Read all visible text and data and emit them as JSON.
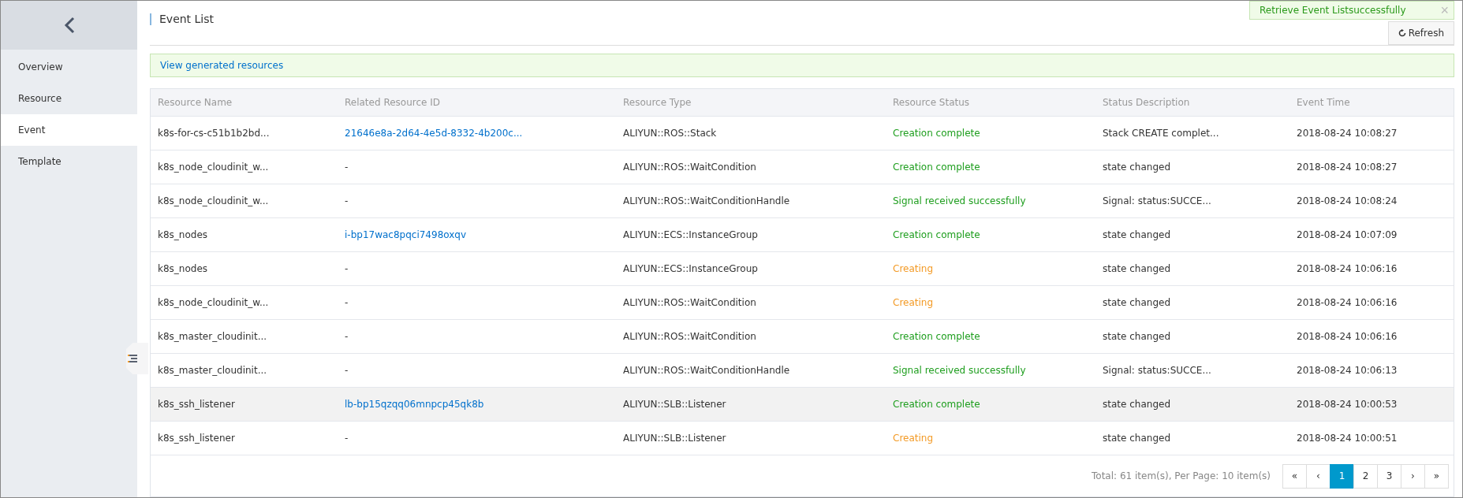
{
  "sidebar": {
    "items": [
      {
        "label": "Overview",
        "selected": false
      },
      {
        "label": "Resource",
        "selected": false
      },
      {
        "label": "Event",
        "selected": true
      },
      {
        "label": "Template",
        "selected": false
      }
    ]
  },
  "page": {
    "title": "Event List",
    "refresh": "Refresh"
  },
  "toast": {
    "message": "Retrieve Event Listsuccessfully",
    "close": "×"
  },
  "notice": {
    "link": "View generated resources"
  },
  "table": {
    "columns": [
      "Resource Name",
      "Related Resource ID",
      "Resource Type",
      "Resource Status",
      "Status Description",
      "Event Time"
    ],
    "rows": [
      {
        "name": "k8s-for-cs-c51b1b2bd...",
        "id": {
          "text": "21646e8a-2d64-4e5d-8332-4b200c...",
          "kind": "link"
        },
        "type": "ALIYUN::ROS::Stack",
        "status": {
          "text": "Creation complete",
          "kind": "done"
        },
        "description": "Stack CREATE complet...",
        "time": "2018-08-24 10:08:27",
        "selected": false
      },
      {
        "name": "k8s_node_cloudinit_w...",
        "id": {
          "text": "-",
          "kind": "plain"
        },
        "type": "ALIYUN::ROS::WaitCondition",
        "status": {
          "text": "Creation complete",
          "kind": "done"
        },
        "description": "state changed",
        "time": "2018-08-24 10:08:27",
        "selected": false
      },
      {
        "name": "k8s_node_cloudinit_w...",
        "id": {
          "text": "-",
          "kind": "plain"
        },
        "type": "ALIYUN::ROS::WaitConditionHandle",
        "status": {
          "text": "Signal received successfully",
          "kind": "done"
        },
        "description": "Signal: status:SUCCE...",
        "time": "2018-08-24 10:08:24",
        "selected": false
      },
      {
        "name": "k8s_nodes",
        "id": {
          "text": "i-bp17wac8pqci7498oxqv",
          "kind": "link"
        },
        "type": "ALIYUN::ECS::InstanceGroup",
        "status": {
          "text": "Creation complete",
          "kind": "done"
        },
        "description": "state changed",
        "time": "2018-08-24 10:07:09",
        "selected": false
      },
      {
        "name": "k8s_nodes",
        "id": {
          "text": "-",
          "kind": "plain"
        },
        "type": "ALIYUN::ECS::InstanceGroup",
        "status": {
          "text": "Creating",
          "kind": "pending"
        },
        "description": "state changed",
        "time": "2018-08-24 10:06:16",
        "selected": false
      },
      {
        "name": "k8s_node_cloudinit_w...",
        "id": {
          "text": "-",
          "kind": "plain"
        },
        "type": "ALIYUN::ROS::WaitCondition",
        "status": {
          "text": "Creating",
          "kind": "pending"
        },
        "description": "state changed",
        "time": "2018-08-24 10:06:16",
        "selected": false
      },
      {
        "name": "k8s_master_cloudinit...",
        "id": {
          "text": "-",
          "kind": "plain"
        },
        "type": "ALIYUN::ROS::WaitCondition",
        "status": {
          "text": "Creation complete",
          "kind": "done"
        },
        "description": "state changed",
        "time": "2018-08-24 10:06:16",
        "selected": false
      },
      {
        "name": "k8s_master_cloudinit...",
        "id": {
          "text": "-",
          "kind": "plain"
        },
        "type": "ALIYUN::ROS::WaitConditionHandle",
        "status": {
          "text": "Signal received successfully",
          "kind": "done"
        },
        "description": "Signal: status:SUCCE...",
        "time": "2018-08-24 10:06:13",
        "selected": false
      },
      {
        "name": "k8s_ssh_listener",
        "id": {
          "text": "lb-bp15qzqq06mnpcp45qk8b",
          "kind": "link"
        },
        "type": "ALIYUN::SLB::Listener",
        "status": {
          "text": "Creation complete",
          "kind": "done"
        },
        "description": "state changed",
        "time": "2018-08-24 10:00:53",
        "selected": true
      },
      {
        "name": "k8s_ssh_listener",
        "id": {
          "text": "-",
          "kind": "plain"
        },
        "type": "ALIYUN::SLB::Listener",
        "status": {
          "text": "Creating",
          "kind": "pending"
        },
        "description": "state changed",
        "time": "2018-08-24 10:00:51",
        "selected": false
      }
    ]
  },
  "pagination": {
    "summary": "Total: 61 item(s), Per Page: 10 item(s)",
    "pages": [
      {
        "label": "«",
        "selected": false
      },
      {
        "label": "‹",
        "selected": false
      },
      {
        "label": "1",
        "selected": true
      },
      {
        "label": "2",
        "selected": false
      },
      {
        "label": "3",
        "selected": false
      },
      {
        "label": "›",
        "selected": false
      },
      {
        "label": "»",
        "selected": false
      }
    ]
  }
}
